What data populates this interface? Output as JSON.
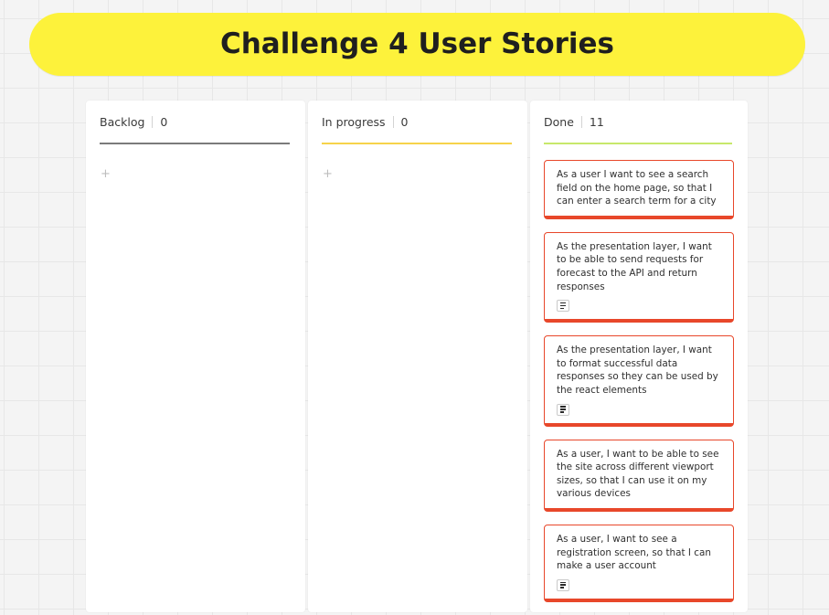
{
  "board": {
    "title": "Challenge 4 User Stories"
  },
  "columns": [
    {
      "name": "Backlog",
      "count": "0",
      "add_symbol": "+",
      "accent_color": "#7b7b7b"
    },
    {
      "name": "In progress",
      "count": "0",
      "add_symbol": "+",
      "accent_color": "#f6d34a"
    },
    {
      "name": "Done",
      "count": "11",
      "accent_color": "#c7e86b",
      "cards": [
        {
          "text": "As a user I want to see a search field on the home page, so that I can enter a search term for a city",
          "has_note": false
        },
        {
          "text": "As the presentation layer, I want to be able to send requests for forecast to the API and return responses",
          "has_note": true,
          "note_icon": "note-lines-icon"
        },
        {
          "text": "As the presentation layer, I want to format successful data responses so they can be used by the react elements",
          "has_note": true,
          "note_icon": "note-lines-icon"
        },
        {
          "text": "As a user, I want to be able to see the site across different viewport sizes, so that I can use it on my various devices",
          "has_note": false
        },
        {
          "text": "As a user, I want to see a registration screen, so that I can make a user account",
          "has_note": true,
          "note_icon": "note-lines-icon"
        }
      ]
    }
  ],
  "colors": {
    "banner": "#fdf23b",
    "card_border": "#e8472a",
    "canvas": "#f4f4f4"
  }
}
